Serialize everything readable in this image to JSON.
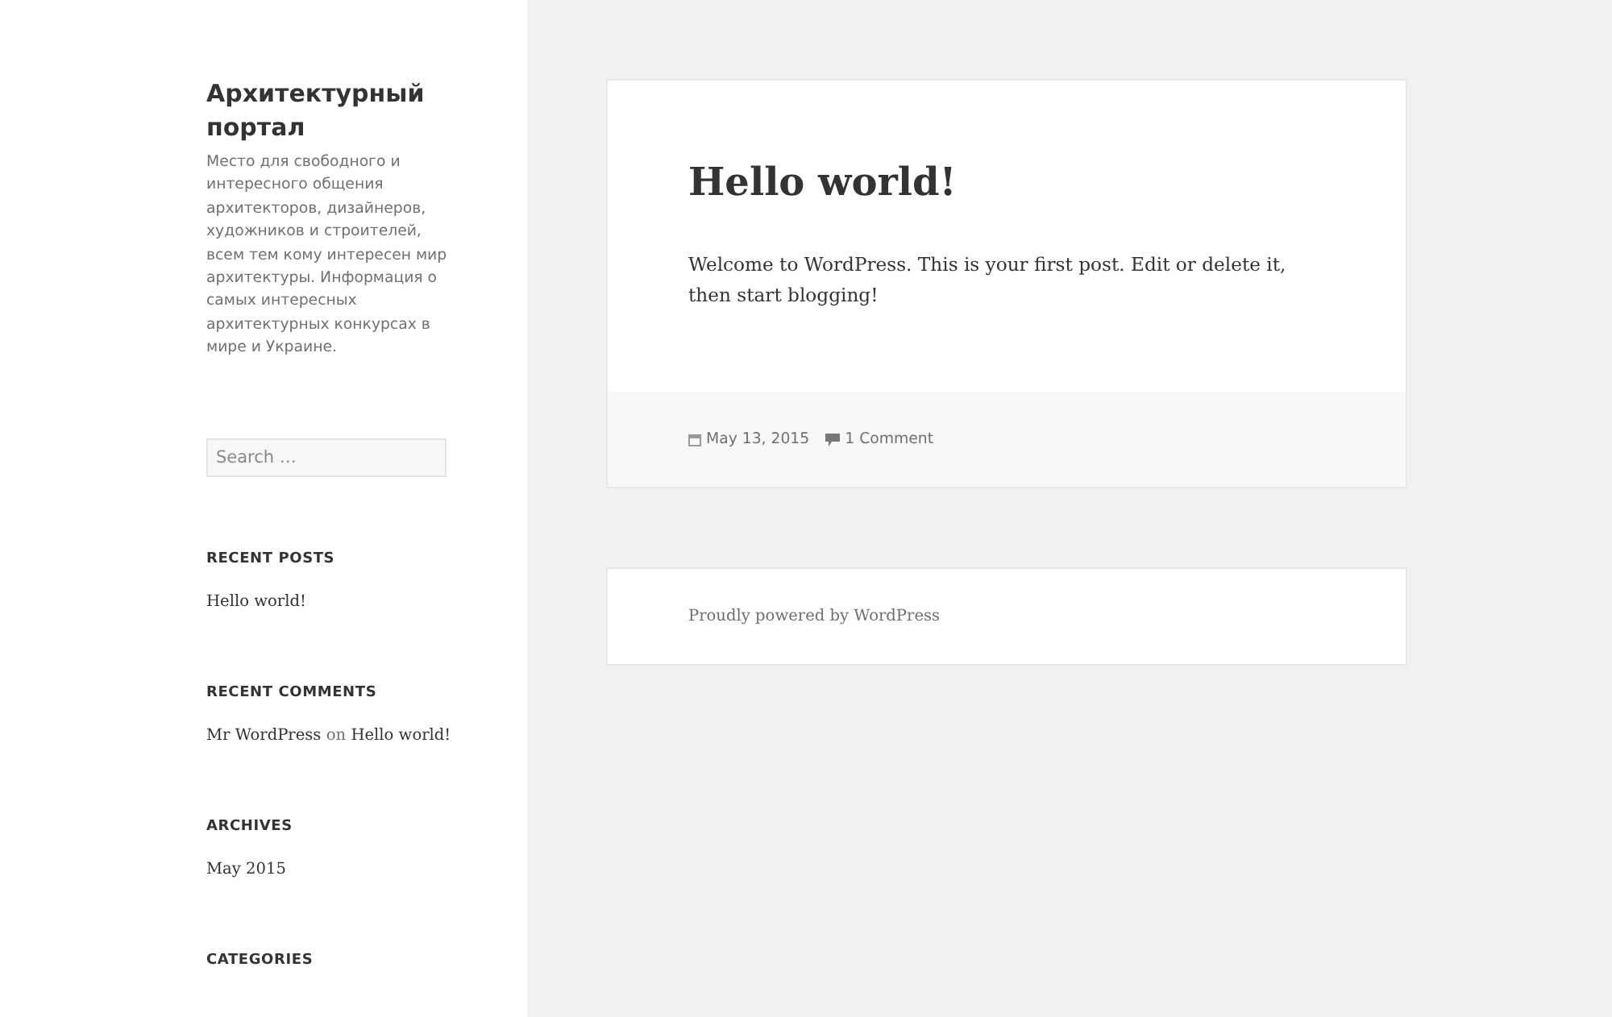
{
  "site": {
    "title": "Архитектурный портал",
    "description": "Место для свободного и интересного общения архитекторов, дизайнеров, художников и строителей, всем тем кому интересен мир архитектуры. Информация о самых интересных архитектурных конкурсах в мире и Украине."
  },
  "search": {
    "placeholder": "Search …"
  },
  "widgets": [
    {
      "title": "RECENT POSTS",
      "links": [
        "Hello world!"
      ]
    },
    {
      "title": "RECENT COMMENTS",
      "comments": [
        {
          "author": "Mr WordPress",
          "joiner": "on",
          "post": "Hello world!"
        }
      ]
    },
    {
      "title": "ARCHIVES",
      "links": [
        "May 2015"
      ]
    },
    {
      "title": "CATEGORIES"
    }
  ],
  "post": {
    "title": "Hello world!",
    "body": "Welcome to WordPress. This is your first post. Edit or delete it, then start blogging!",
    "date": "May 13, 2015",
    "comments": "1 Comment"
  },
  "footer": {
    "text": "Proudly powered by WordPress"
  }
}
